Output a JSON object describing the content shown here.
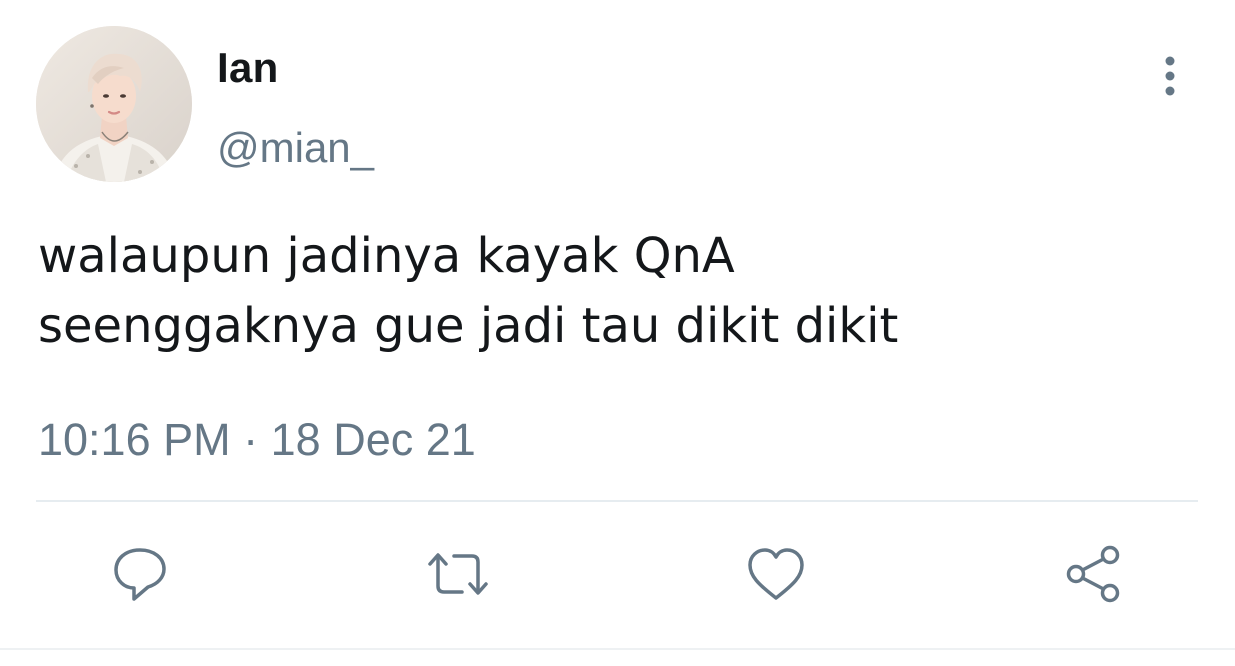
{
  "author": {
    "display_name": "Ian",
    "handle": "@mian_"
  },
  "tweet": {
    "text": "walaupun jadinya kayak QnA\nseenggaknya gue jadi tau dikit dikit",
    "time": "10:16 PM",
    "separator": "·",
    "date": "18 Dec 21"
  },
  "icons": {
    "more": "more-vertical-icon",
    "reply": "reply-icon",
    "retweet": "retweet-icon",
    "like": "heart-icon",
    "share": "share-icon"
  },
  "colors": {
    "text": "#14171a",
    "secondary": "#657786",
    "divider": "#e6ecf0"
  }
}
